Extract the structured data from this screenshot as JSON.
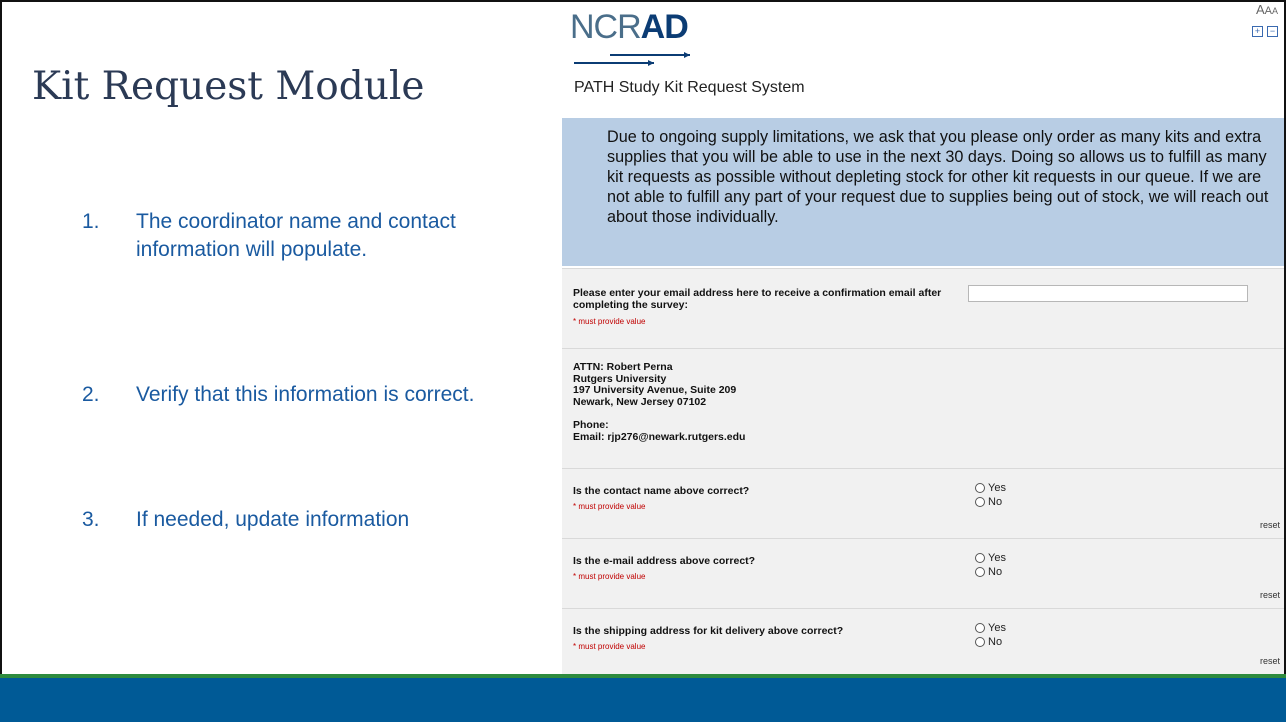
{
  "slide": {
    "title": "Kit Request Module",
    "steps": [
      {
        "number": "1.",
        "text": "The coordinator name and contact information will populate."
      },
      {
        "number": "2.",
        "text": "Verify that this information is correct."
      },
      {
        "number": "3.",
        "text": "If needed, update information"
      }
    ],
    "colors": {
      "title": "#2b3a55",
      "steps": "#1a5aa0",
      "footer_bar": "#005a96",
      "footer_stripe": "#2e8b3e"
    }
  },
  "survey": {
    "logo": {
      "prefix": "NCR",
      "suffix": "AD"
    },
    "text_size": {
      "label_large": "A",
      "label_medium": "A",
      "label_small": "A",
      "increase": "+",
      "decrease": "−"
    },
    "title": "PATH Study Kit Request System",
    "notice": "Due to ongoing supply limitations, we ask that you please only order as many kits and extra supplies that you will be able to use in the next 30 days. Doing so allows us to fulfill as many kit requests as possible without depleting stock for other kit requests in our queue. If we are not able to fulfill any part of your request due to supplies being out of stock, we will reach out about those individually.",
    "email_question": {
      "label": "Please enter your email address here to receive a confirmation email after completing the survey:",
      "required": "* must provide value",
      "value": ""
    },
    "address": {
      "attn": "ATTN: Robert Perna",
      "org": "Rutgers University",
      "street": "197 University Avenue, Suite 209",
      "city": "Newark, New Jersey 07102",
      "phone": "Phone:",
      "email": "Email: rjp276@newark.rutgers.edu"
    },
    "questions": [
      {
        "label": "Is the contact name above correct?",
        "required": "* must provide value",
        "yes": "Yes",
        "no": "No",
        "reset": "reset"
      },
      {
        "label": "Is the e-mail address above correct?",
        "required": "* must provide value",
        "yes": "Yes",
        "no": "No",
        "reset": "reset"
      },
      {
        "label": "Is the shipping address for kit delivery above correct?",
        "required": "* must provide value",
        "yes": "Yes",
        "no": "No",
        "reset": "reset"
      }
    ]
  }
}
